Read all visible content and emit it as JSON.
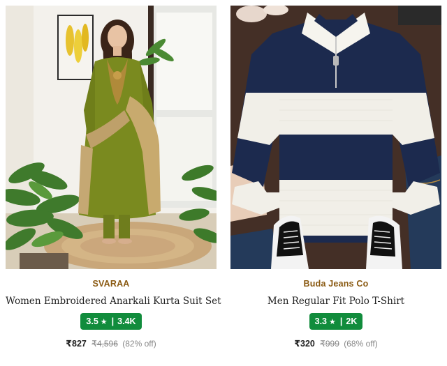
{
  "products": [
    {
      "brand": "SVARAA",
      "title": "Women Embroidered Anarkali Kurta Suit Set",
      "rating": "3.5",
      "star": "★",
      "rating_count": "3.4K",
      "price": "₹827",
      "mrp": "₹4,596",
      "discount": "(82% off)",
      "image_name": "product-image-kurta-suit"
    },
    {
      "brand": "Buda Jeans Co",
      "title": "Men Regular Fit Polo T-Shirt",
      "rating": "3.3",
      "star": "★",
      "rating_count": "2K",
      "price": "₹320",
      "mrp": "₹999",
      "discount": "(68% off)",
      "image_name": "product-image-polo-tshirt"
    }
  ],
  "colors": {
    "brand": "#8a5a12",
    "rating_badge": "#118c3c",
    "price": "#212121",
    "muted": "#878787"
  }
}
